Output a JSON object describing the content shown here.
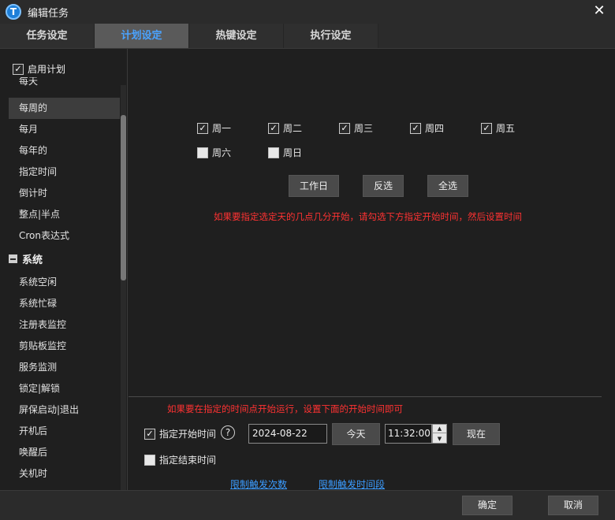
{
  "window": {
    "title": "编辑任务",
    "logo_letter": "T"
  },
  "tabs": [
    {
      "label": "任务设定",
      "active": false
    },
    {
      "label": "计划设定",
      "active": true
    },
    {
      "label": "热键设定",
      "active": false
    },
    {
      "label": "执行设定",
      "active": false
    }
  ],
  "sidebar": {
    "enable_label": "启用计划",
    "items": [
      {
        "label": "每天"
      },
      {
        "label": "每周的",
        "selected": true
      },
      {
        "label": "每月"
      },
      {
        "label": "每年的"
      },
      {
        "label": "指定时间"
      },
      {
        "label": "倒计时"
      },
      {
        "label": "整点|半点"
      },
      {
        "label": "Cron表达式"
      }
    ],
    "group_system": "系统",
    "system_items": [
      {
        "label": "系统空闲"
      },
      {
        "label": "系统忙碌"
      },
      {
        "label": "注册表监控"
      },
      {
        "label": "剪贴板监控"
      },
      {
        "label": "服务监测"
      },
      {
        "label": "锁定|解锁"
      },
      {
        "label": "屏保启动|退出"
      },
      {
        "label": "开机后"
      },
      {
        "label": "唤醒后"
      },
      {
        "label": "关机时"
      }
    ]
  },
  "weekdays": [
    {
      "label": "周一",
      "checked": true
    },
    {
      "label": "周二",
      "checked": true
    },
    {
      "label": "周三",
      "checked": true
    },
    {
      "label": "周四",
      "checked": true
    },
    {
      "label": "周五",
      "checked": true
    },
    {
      "label": "周六",
      "checked": false
    },
    {
      "label": "周日",
      "checked": false
    }
  ],
  "buttons": {
    "workday": "工作日",
    "invert": "反选",
    "select_all": "全选"
  },
  "hint_top": "如果要指定选定天的几点几分开始，请勾选下方指定开始时间，然后设置时间",
  "hint_bottom": "如果要在指定的时间点开始运行，设置下面的开始时间即可",
  "start_time": {
    "label": "指定开始时间",
    "checked": true,
    "help": "?",
    "date_value": "2024-08-22",
    "today_label": "今天",
    "time_value": "11:32:00",
    "now_label": "现在"
  },
  "end_time": {
    "label": "指定结束时间",
    "checked": false
  },
  "links": {
    "limit_count": "限制触发次数",
    "limit_period": "限制触发时间段"
  },
  "footer": {
    "ok": "确定",
    "cancel": "取消"
  },
  "colors": {
    "accent": "#4aa3ff",
    "hint": "#ff3232",
    "link": "#3b9cff"
  },
  "icons": {
    "close": "close-icon",
    "collapse": "collapse-minus-icon",
    "help": "help-icon",
    "spinner_up": "chevron-up-icon",
    "spinner_down": "chevron-down-icon"
  }
}
